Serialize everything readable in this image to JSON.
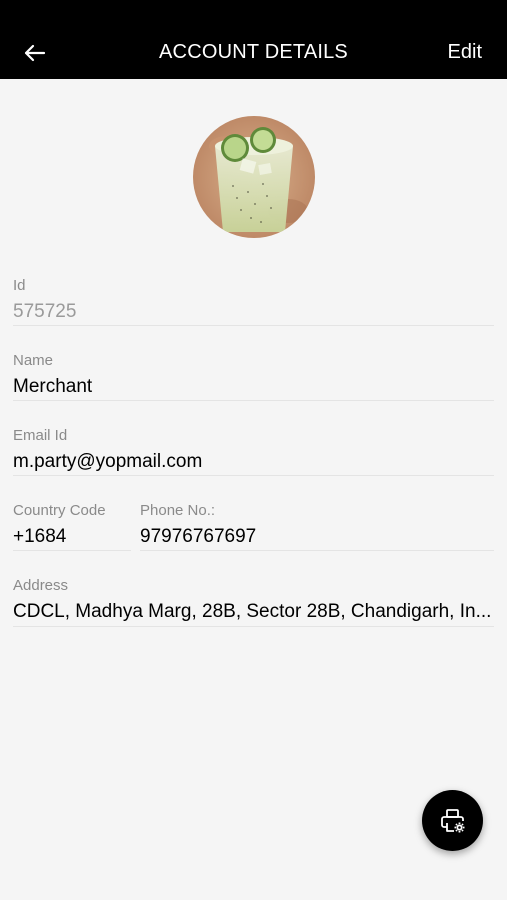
{
  "header": {
    "title": "ACCOUNT DETAILS",
    "edit_label": "Edit",
    "back_icon": "arrow-left-icon"
  },
  "profile": {
    "avatar": "drink-glass-image"
  },
  "fields": {
    "id": {
      "label": "Id",
      "value": "575725"
    },
    "name": {
      "label": "Name",
      "value": "Merchant"
    },
    "email": {
      "label": "Email Id",
      "value": "m.party@yopmail.com"
    },
    "country_code": {
      "label": "Country Code",
      "value": "+1684"
    },
    "phone": {
      "label": "Phone No.:",
      "value": "97976767697"
    },
    "address": {
      "label": "Address",
      "value": "CDCL, Madhya Marg, 28B, Sector 28B, Chandigarh, In..."
    }
  },
  "fab": {
    "icon": "printer-settings-icon"
  },
  "colors": {
    "header_bg": "#000000",
    "page_bg": "#f5f5f5",
    "label": "#8a8a8a",
    "divider": "#e4e4e4"
  }
}
